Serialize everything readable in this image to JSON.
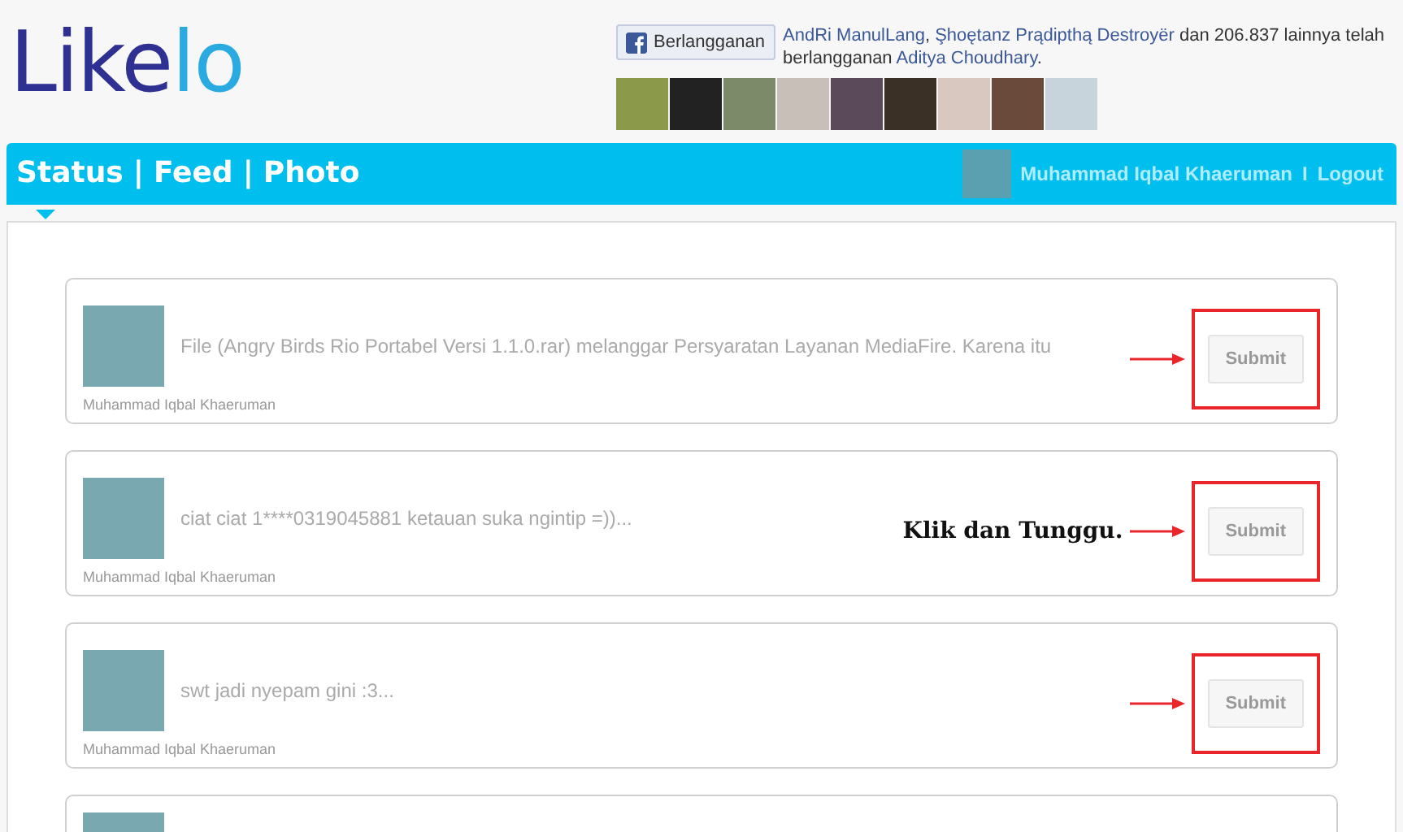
{
  "logo": {
    "dark_part": "Like",
    "light_part": "lo"
  },
  "subscribe": {
    "button": "Berlangganan",
    "names": [
      "AndRi ManulLang",
      "Şhoętanz Prądipthą Destroyër"
    ],
    "joiner": ", ",
    "middle": " dan 206.837 lainnya telah berlangganan ",
    "target": "Aditya Choudhary",
    "end": "."
  },
  "nav": {
    "links": [
      {
        "label": "Status",
        "selected": true
      },
      {
        "label": "Feed",
        "selected": false
      },
      {
        "label": "Photo",
        "selected": false
      }
    ],
    "separator": "|"
  },
  "user": {
    "name": "Muhammad Iqbal Khaeruman",
    "separator": "I",
    "logout": "Logout"
  },
  "posts": [
    {
      "kind": "full",
      "text": "File (Angry Birds Rio Portabel Versi 1.1.0.rar) melanggar Persyaratan Layanan MediaFire. Karena itu",
      "author": "Muhammad Iqbal Khaeruman",
      "button": "Submit",
      "highlighted": true
    },
    {
      "kind": "full",
      "text": "ciat ciat 1****0319045881 ketauan suka ngintip =))...",
      "author": "Muhammad Iqbal Khaeruman",
      "button": "Submit",
      "highlighted": true,
      "note": "Klik dan Tunggu."
    },
    {
      "kind": "full",
      "text": "swt jadi nyepam gini :3...",
      "author": "Muhammad Iqbal Khaeruman",
      "button": "Submit",
      "highlighted": true
    },
    {
      "kind": "partial"
    }
  ]
}
